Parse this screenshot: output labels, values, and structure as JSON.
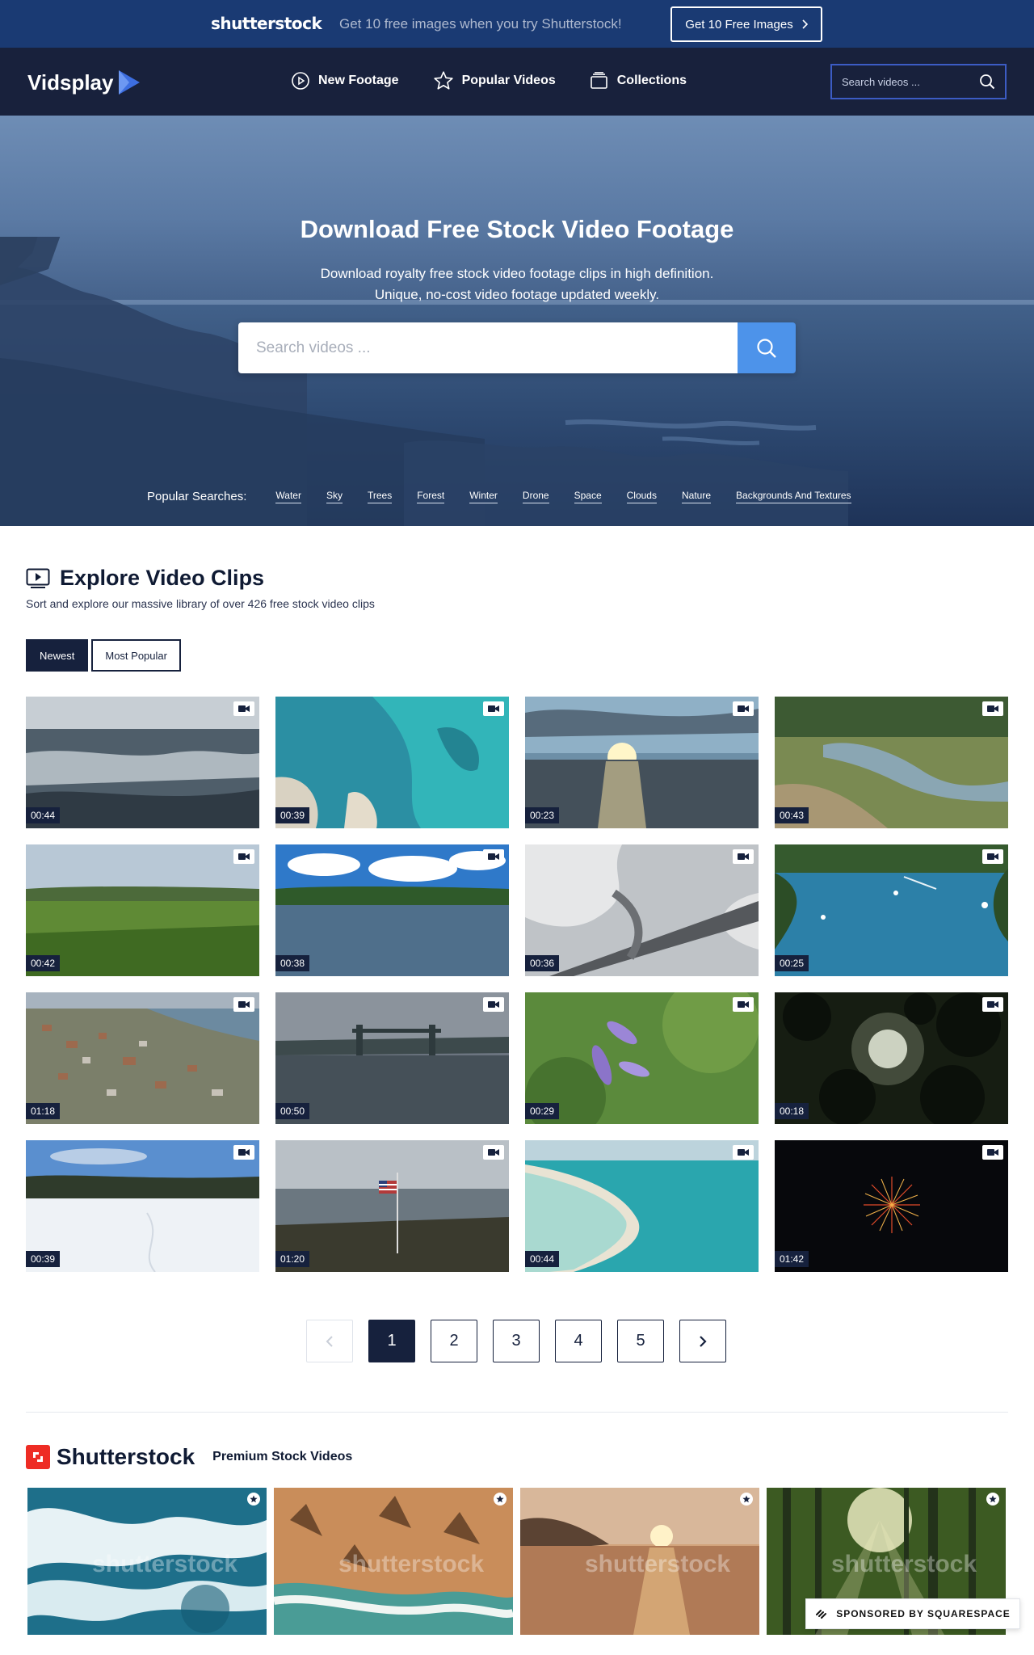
{
  "promo": {
    "logo": "shutterstock",
    "message": "Get 10 free images when you try Shutterstock!",
    "cta_label": "Get 10 Free Images",
    "cta_icon": "chevron-right-icon"
  },
  "nav": {
    "brand": "Vidsplay",
    "links": [
      {
        "label": "New Footage",
        "icon": "play-circle-icon"
      },
      {
        "label": "Popular Videos",
        "icon": "star-icon"
      },
      {
        "label": "Collections",
        "icon": "collections-icon"
      }
    ],
    "search_placeholder": "Search videos ..."
  },
  "hero": {
    "title": "Download Free Stock Video Footage",
    "subtitle_line1": "Download royalty free stock video footage clips in high definition.",
    "subtitle_line2": "Unique, no-cost video footage updated weekly.",
    "search_placeholder": "Search videos ...",
    "popular_label": "Popular Searches:",
    "popular_tags": [
      "Water",
      "Sky",
      "Trees",
      "Forest",
      "Winter",
      "Drone",
      "Space",
      "Clouds",
      "Nature",
      "Backgrounds And Textures"
    ]
  },
  "explore": {
    "title": "Explore Video Clips",
    "description": "Sort and explore our massive library of over 426 free stock video clips",
    "filters": [
      {
        "label": "Newest",
        "active": true
      },
      {
        "label": "Most Popular",
        "active": false
      }
    ]
  },
  "videos": [
    {
      "duration": "00:44",
      "scene": "ocean-waves"
    },
    {
      "duration": "00:39",
      "scene": "aerial-reef"
    },
    {
      "duration": "00:23",
      "scene": "sunset-sea"
    },
    {
      "duration": "00:43",
      "scene": "marsh-aerial"
    },
    {
      "duration": "00:42",
      "scene": "green-field"
    },
    {
      "duration": "00:38",
      "scene": "lake-clouds"
    },
    {
      "duration": "00:36",
      "scene": "snow-bridge"
    },
    {
      "duration": "00:25",
      "scene": "river-boats"
    },
    {
      "duration": "01:18",
      "scene": "town-aerial"
    },
    {
      "duration": "00:50",
      "scene": "bridge-river"
    },
    {
      "duration": "00:29",
      "scene": "purple-flower"
    },
    {
      "duration": "00:18",
      "scene": "trees-sun"
    },
    {
      "duration": "00:39",
      "scene": "snow-field"
    },
    {
      "duration": "01:20",
      "scene": "flag-shore"
    },
    {
      "duration": "00:44",
      "scene": "turquoise-beach"
    },
    {
      "duration": "01:42",
      "scene": "fireworks"
    }
  ],
  "pager": {
    "pages": [
      "1",
      "2",
      "3",
      "4",
      "5"
    ],
    "current": "1"
  },
  "sponsor": {
    "name": "Shutterstock",
    "tagline": "Premium Stock Videos",
    "watermark": "shutterstock",
    "items": [
      "ocean-surf",
      "palm-beach",
      "beach-sunset",
      "forest-sunbeams"
    ],
    "badge": "SPONSORED BY SQUARESPACE"
  },
  "colors": {
    "promo_bg": "#1a3a73",
    "nav_bg": "#18213c",
    "accent_blue": "#4d93ea",
    "dark": "#16213d",
    "shutterstock_red": "#ee2c24"
  }
}
